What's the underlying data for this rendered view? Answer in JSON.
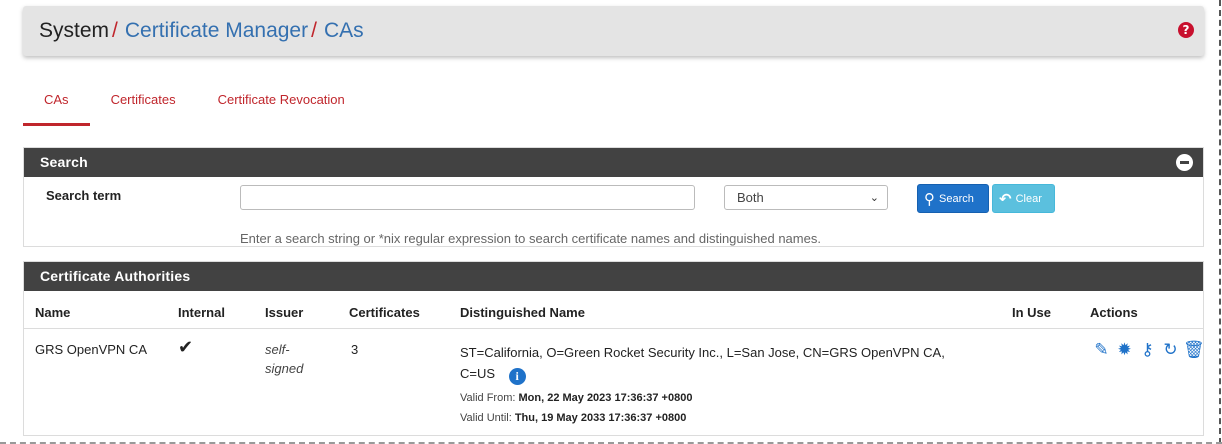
{
  "breadcrumb": {
    "system": "System",
    "separator": "/",
    "certificate_manager": "Certificate Manager",
    "cas": "CAs"
  },
  "help_icon": "?",
  "tabs": [
    {
      "label": "CAs",
      "active": true
    },
    {
      "label": "Certificates",
      "active": false
    },
    {
      "label": "Certificate Revocation",
      "active": false
    }
  ],
  "search_panel": {
    "title": "Search",
    "term_label": "Search term",
    "input_value": "",
    "scope_selected": "Both",
    "search_button": "Search",
    "clear_button": "Clear",
    "help_text": "Enter a search string or *nix regular expression to search certificate names and distinguished names."
  },
  "ca_panel": {
    "title": "Certificate Authorities",
    "columns": [
      "Name",
      "Internal",
      "Issuer",
      "Certificates",
      "Distinguished Name",
      "In Use",
      "Actions"
    ],
    "rows": [
      {
        "name": "GRS OpenVPN CA",
        "internal": "✔",
        "issuer_line1": "self-",
        "issuer_line2": "signed",
        "certificates": "3",
        "dn_line1": "ST=California, O=Green Rocket Security Inc., L=San Jose, CN=GRS OpenVPN CA,",
        "dn_line2": "C=US",
        "valid_from_label": "Valid From:",
        "valid_from": "Mon, 22 May 2023 17:36:37 +0800",
        "valid_until_label": "Valid Until:",
        "valid_until": "Thu, 19 May 2033 17:36:37 +0800",
        "in_use": ""
      }
    ],
    "action_icons": [
      "pencil-icon",
      "certificate-icon",
      "key-icon",
      "renew-icon",
      "trash-icon"
    ]
  },
  "colors": {
    "accent_red": "#c0262c",
    "link_blue": "#3470b0",
    "panel_header": "#424242",
    "primary_button": "#1f72c9",
    "info_button": "#5bc0de"
  }
}
